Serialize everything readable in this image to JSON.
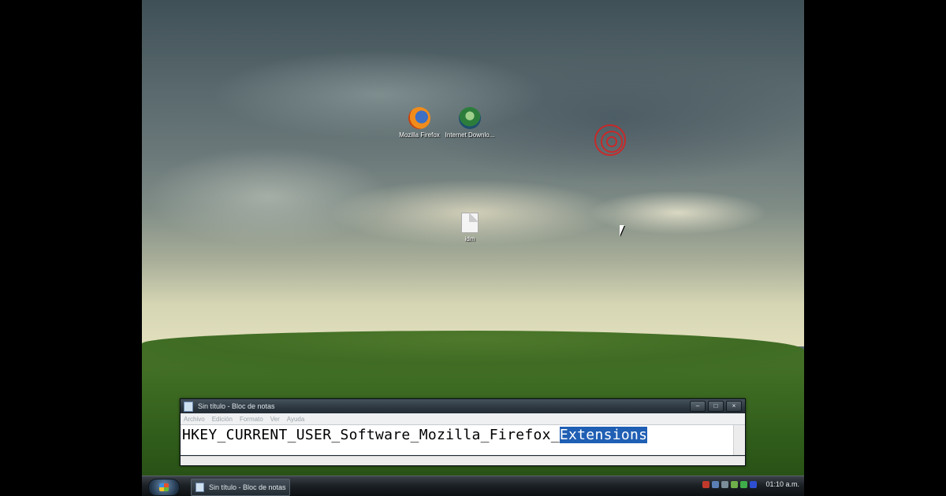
{
  "desktop": {
    "icons": [
      {
        "label": "Mozilla Firefox"
      },
      {
        "label": "Internet Downlo..."
      },
      {
        "label": "idm"
      }
    ]
  },
  "notepad": {
    "title": "Sin título - Bloc de notas",
    "menu": [
      "Archivo",
      "Edición",
      "Formato",
      "Ver",
      "Ayuda"
    ],
    "text_plain": "HKEY_CURRENT_USER_Software_Mozilla_Firefox_",
    "text_selected": "Extensions",
    "controls": {
      "minimize": "–",
      "maximize": "□",
      "close": "×"
    }
  },
  "taskbar": {
    "task_label": "Sin título - Bloc de notas",
    "clock": "01:10 a.m.",
    "tray_colors": [
      "#c0392b",
      "#5b7fb5",
      "#7a8d99",
      "#6fb04a",
      "#3fae4a",
      "#2e4fd1"
    ]
  }
}
